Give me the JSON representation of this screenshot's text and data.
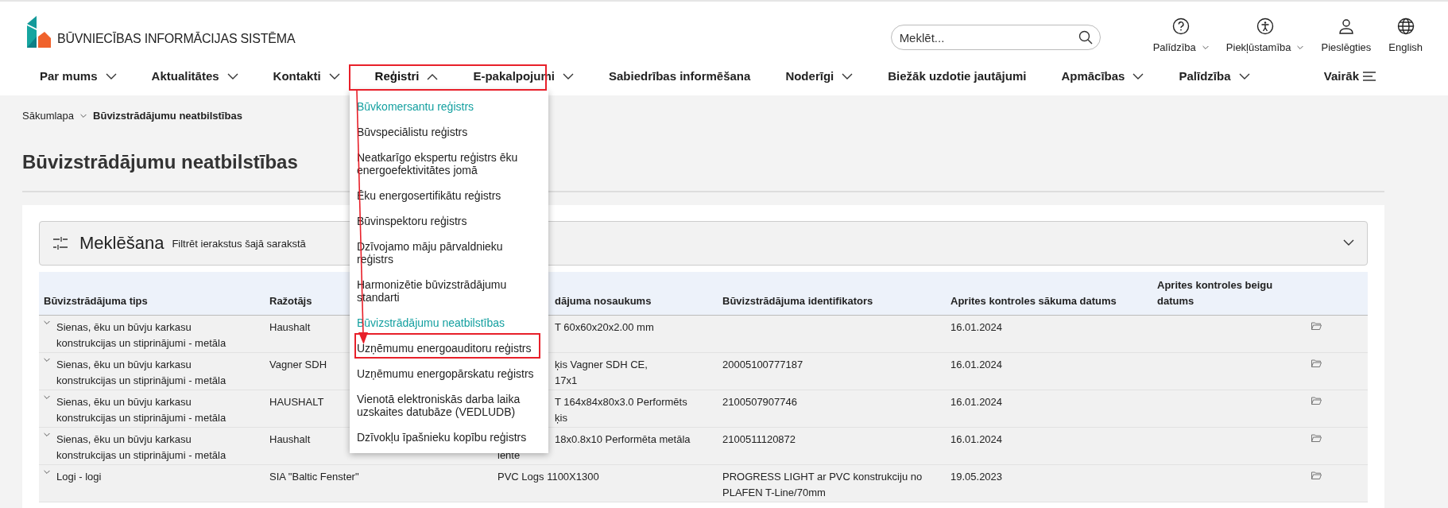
{
  "header": {
    "logo_text": "BŪVNIECĪBAS INFORMĀCIJAS SISTĒMA",
    "search": {
      "placeholder": "Meklēt..."
    },
    "utilities": [
      {
        "kind": "help",
        "label": "Palīdzība",
        "has_menu": true
      },
      {
        "kind": "accessibility",
        "label": "Piekļūstamība",
        "has_menu": true
      },
      {
        "kind": "user",
        "label": "Pieslēgties",
        "has_menu": false
      },
      {
        "kind": "globe",
        "label": "English",
        "has_menu": false
      }
    ]
  },
  "nav": {
    "items": [
      {
        "label": "Par mums",
        "kind": "menu",
        "expanded": false
      },
      {
        "label": "Aktualitātes",
        "kind": "menu",
        "expanded": false
      },
      {
        "label": "Kontakti",
        "kind": "menu",
        "expanded": false
      },
      {
        "label": "Reģistri",
        "kind": "menu",
        "expanded": true
      },
      {
        "label": "E-pakalpojumi",
        "kind": "menu",
        "expanded": false
      },
      {
        "label": "Sabiedrības informēšana",
        "kind": "link",
        "expanded": false
      },
      {
        "label": "Noderīgi",
        "kind": "menu",
        "expanded": false
      },
      {
        "label": "Biežāk uzdotie jautājumi",
        "kind": "link",
        "expanded": false
      },
      {
        "label": "Apmācības",
        "kind": "menu",
        "expanded": false
      },
      {
        "label": "Palīdzība",
        "kind": "menu",
        "expanded": false
      }
    ],
    "more": "Vairāk"
  },
  "dropdown": {
    "items": [
      {
        "label": "Būvkomersantu reģistrs",
        "active": true
      },
      {
        "label": "Būvspeciālistu reģistrs",
        "active": false
      },
      {
        "label": "Neatkarīgo ekspertu reģistrs ēku energoefektivitātes jomā",
        "active": false
      },
      {
        "label": "Ēku energosertifikātu reģistrs",
        "active": false
      },
      {
        "label": "Būvinspektoru reģistrs",
        "active": false
      },
      {
        "label": "Dzīvojamo māju pārvaldnieku reģistrs",
        "active": false
      },
      {
        "label": "Harmonizētie būvizstrādājumu standarti",
        "active": false
      },
      {
        "label": "Būvizstrādājumu neatbilstības",
        "active": true
      },
      {
        "label": "Uzņēmumu energoauditoru reģistrs",
        "active": false
      },
      {
        "label": "Uzņēmumu energopārskatu reģistrs",
        "active": false
      },
      {
        "label": "Vienotā elektroniskās darba laika uzskaites datubāze (VEDLUDB)",
        "active": false
      },
      {
        "label": "Dzīvokļu īpašnieku kopību reģistrs",
        "active": false
      }
    ]
  },
  "breadcrumb": [
    "Sākumlapa",
    "Būvizstrādājumu neatbilstības"
  ],
  "page_title": "Būvizstrādājumu neatbilstības",
  "search_panel": {
    "title": "Meklēšana",
    "subtitle": "Filtrēt ierakstus šajā sarakstā"
  },
  "table": {
    "columns": [
      "Būvizstrādājuma tips",
      "Ražotājs",
      "dājuma nosaukums",
      "Būvizstrādājuma identifikators",
      "Aprites kontroles sākuma datums",
      "Aprites kontroles beigu datums"
    ],
    "rows": [
      {
        "type": "Sienas, ēku un būvju karkasu konstrukcijas un stiprinājumi - metāla",
        "maker": "Haushalt",
        "name": [
          "T 60x60x20x2.00 mm"
        ],
        "identifier": "",
        "start": "16.01.2024",
        "end": ""
      },
      {
        "type": "Sienas, ēku un būvju karkasu konstrukcijas un stiprinājumi - metāla",
        "maker": "Vagner SDH",
        "name": [
          "ķis Vagner SDH CE,",
          "17x1"
        ],
        "identifier": "20005100777187",
        "start": "16.01.2024",
        "end": ""
      },
      {
        "type": "Sienas, ēku un būvju karkasu konstrukcijas un stiprinājumi - metāla",
        "maker": "HAUSHALT",
        "name": [
          "T 164x84x80x3.0 Performēts",
          "ķis"
        ],
        "identifier": "2100507907746",
        "start": "16.01.2024",
        "end": ""
      },
      {
        "type": "Sienas, ēku un būvju karkasu konstrukcijas un stiprinājumi - metāla",
        "maker": "Haushalt",
        "name": [
          "18x0.8x10 Performēta metāla",
          "lente"
        ],
        "identifier": "2100511120872",
        "start": "16.01.2024",
        "end": ""
      },
      {
        "type": "Logi - logi",
        "maker": "SIA \"Baltic Fenster\"",
        "name": [
          "PVC Logs 1100X1300"
        ],
        "identifier": "PROGRESS LIGHT ar PVC konstrukciju no PLAFEN T-Line/70mm",
        "start": "19.05.2023",
        "end": ""
      }
    ]
  }
}
